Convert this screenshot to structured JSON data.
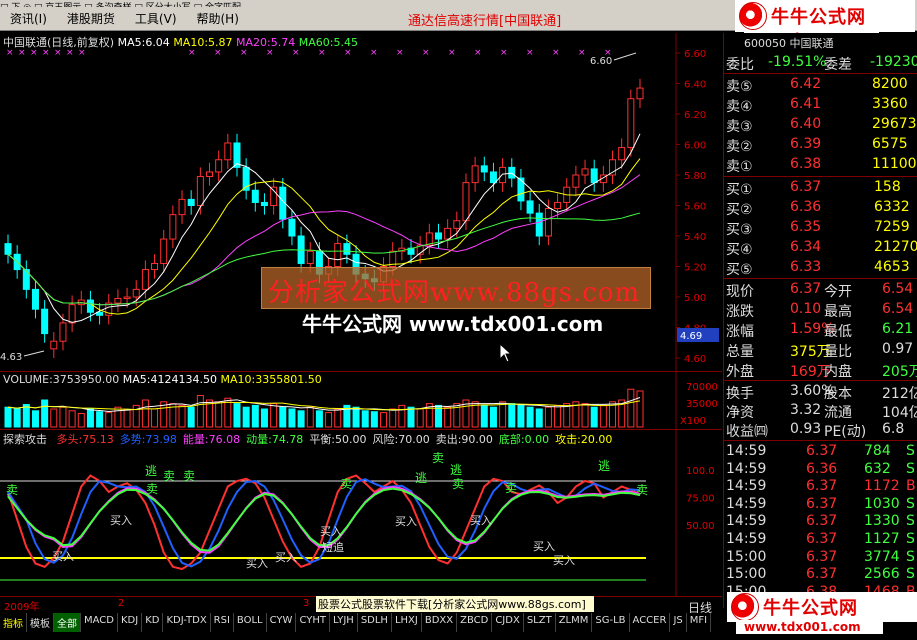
{
  "menu": {
    "strip_text": "□ 下 ◎ □ 京王图示 □ 多沟奇样 □ 区分大小写 □ 全字匹配",
    "items": [
      "资讯(I)",
      "港股期货",
      "工具(V)",
      "帮助(H)"
    ],
    "title": "通达信高速行情[中国联通]"
  },
  "logo": {
    "name": "牛牛公式网",
    "url": "www.tdx001.com"
  },
  "main_chart": {
    "stock_label": "中国联通(日线,前复权)",
    "ma5": "MA5:6.04",
    "ma10": "MA10:5.87",
    "ma20": "MA20:5.74",
    "ma60": "MA60:5.45",
    "high_marker": "6.60",
    "low_marker": "4.63",
    "current_price_tag": "4.69",
    "y_ticks": [
      "6.60",
      "6.40",
      "6.20",
      "6.00",
      "5.80",
      "5.60",
      "5.40",
      "5.20",
      "5.00",
      "4.80",
      "4.60"
    ],
    "colors": {
      "ma5": "#ffffff",
      "ma10": "#ffff00",
      "ma20": "#ff00ff",
      "ma60": "#00ff00",
      "up": "#ff3030",
      "down": "#00ffff"
    }
  },
  "volume_chart": {
    "label": "VOLUME:3753950.00",
    "ma5": "MA5:4124134.50",
    "ma10": "MA10:3355801.50",
    "y_ticks": [
      "70000",
      "35000"
    ],
    "unit": "X100"
  },
  "indicator": {
    "name": "探索攻击",
    "items": [
      {
        "label": "多头:75.13",
        "color": "#ff3030"
      },
      {
        "label": "多势:73.98",
        "color": "#2060ff"
      },
      {
        "label": "能量:76.08",
        "color": "#ff40ff"
      },
      {
        "label": "动量:74.78",
        "color": "#40ff40"
      },
      {
        "label": "平衡:50.00",
        "color": "#dddddd"
      },
      {
        "label": "风险:70.00",
        "color": "#dddddd"
      },
      {
        "label": "卖出:90.00",
        "color": "#dddddd"
      },
      {
        "label": "底部:0.00",
        "color": "#40ff40"
      },
      {
        "label": "攻击:20.00",
        "color": "#ffff00"
      }
    ],
    "y_ticks": [
      "100.0",
      "75.00",
      "50.00"
    ],
    "signals_sell": [
      "卖",
      "逃",
      "卖",
      "卖",
      "卖",
      "卖",
      "逃",
      "卖",
      "逃",
      "卖",
      "卖",
      "逃",
      "卖"
    ],
    "signals_buy": [
      "买入",
      "买入",
      "买入",
      "买入",
      "买入",
      "买入",
      "买入",
      "买入",
      "买入"
    ],
    "special": "短追"
  },
  "ads": {
    "banner": "分析家公式网www.88gs.com",
    "overlay": "牛牛公式网 www.tdx001.com",
    "footer": "股票公式股票软件下载[分析家公式网www.88gs.com]"
  },
  "date_axis": {
    "year": "2009年",
    "m2": "2",
    "m3": "3"
  },
  "period_label": "日线",
  "tabs": [
    "指标",
    "模板",
    "全部",
    "MACD",
    "KDJ",
    "KD",
    "KDJ-TDX",
    "RSI",
    "BOLL",
    "CYW",
    "CYHT",
    "LYJH",
    "SDLH",
    "LHXJ",
    "BDXX",
    "ZBCD",
    "CJDX",
    "SLZT",
    "ZLMM",
    "SG-LB",
    "ACCER",
    "JS",
    "MFI"
  ],
  "quote": {
    "code": "600050 中国联通",
    "weibi_label": "委比",
    "weibi_value": "-19.51%",
    "weicha_label": "委差",
    "weicha_value": "-19230",
    "sell": [
      {
        "label": "卖⑤",
        "price": "6.42",
        "vol": "8200"
      },
      {
        "label": "卖④",
        "price": "6.41",
        "vol": "3360"
      },
      {
        "label": "卖③",
        "price": "6.40",
        "vol": "29673"
      },
      {
        "label": "卖②",
        "price": "6.39",
        "vol": "6575"
      },
      {
        "label": "卖①",
        "price": "6.38",
        "vol": "11100"
      }
    ],
    "buy": [
      {
        "label": "买①",
        "price": "6.37",
        "vol": "158"
      },
      {
        "label": "买②",
        "price": "6.36",
        "vol": "6332"
      },
      {
        "label": "买③",
        "price": "6.35",
        "vol": "7259"
      },
      {
        "label": "买④",
        "price": "6.34",
        "vol": "21270"
      },
      {
        "label": "买⑤",
        "price": "6.33",
        "vol": "4653"
      }
    ],
    "stats": [
      {
        "l1": "现价",
        "v1": "6.37",
        "l2": "今开",
        "v2": "6.54"
      },
      {
        "l1": "涨跌",
        "v1": "0.10",
        "l2": "最高",
        "v2": "6.54"
      },
      {
        "l1": "涨幅",
        "v1": "1.59%",
        "l2": "最低",
        "v2": "6.21"
      },
      {
        "l1": "总量",
        "v1": "375万",
        "l2": "量比",
        "v2": "0.97"
      },
      {
        "l1": "外盘",
        "v1": "169万",
        "l2": "内盘",
        "v2": "205万"
      }
    ],
    "stats2": [
      {
        "l1": "换手",
        "v1": "3.60%",
        "l2": "股本",
        "v2": "212亿"
      },
      {
        "l1": "净资",
        "v1": "3.32",
        "l2": "流通",
        "v2": "104亿"
      },
      {
        "l1": "收益㈣",
        "v1": "0.93",
        "l2": "PE(动)",
        "v2": "6.8"
      }
    ],
    "ticks": [
      {
        "t": "14:59",
        "p": "6.37",
        "v": "784",
        "d": "S"
      },
      {
        "t": "14:59",
        "p": "6.36",
        "v": "632",
        "d": "S"
      },
      {
        "t": "14:59",
        "p": "6.37",
        "v": "1172",
        "d": "B"
      },
      {
        "t": "14:59",
        "p": "6.37",
        "v": "1030",
        "d": "S"
      },
      {
        "t": "14:59",
        "p": "6.37",
        "v": "1330",
        "d": "S"
      },
      {
        "t": "14:59",
        "p": "6.37",
        "v": "1127",
        "d": "S"
      },
      {
        "t": "15:00",
        "p": "6.37",
        "v": "3774",
        "d": "S"
      },
      {
        "t": "15:00",
        "p": "6.37",
        "v": "2566",
        "d": "S"
      },
      {
        "t": "15:00",
        "p": "6.38",
        "v": "1468",
        "d": "B"
      }
    ]
  }
}
